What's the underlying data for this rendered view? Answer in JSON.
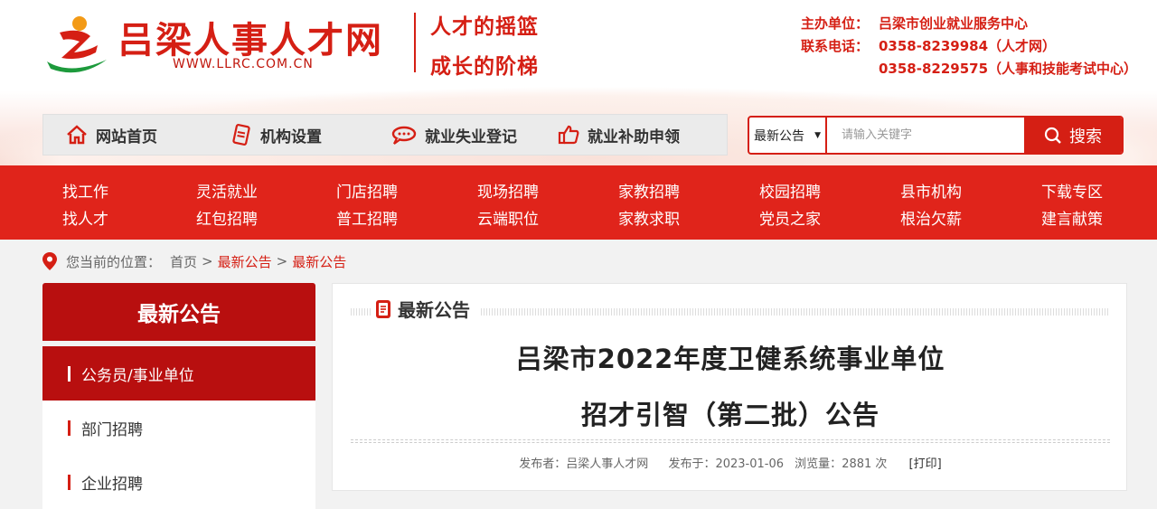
{
  "header": {
    "site_name": "吕梁人事人才网",
    "site_url": "WWW.LLRC.COM.CN",
    "slogan_1": "人才的摇篮",
    "slogan_2": "成长的阶梯",
    "host_label": "主办单位：",
    "host_value": "吕梁市创业就业服务中心",
    "phone_label": "联系电话：",
    "phone_1": "0358-8239984（人才网）",
    "phone_2": "0358-8229575（人事和技能考试中心）"
  },
  "topnav": [
    {
      "label": "网站首页",
      "icon": "home-icon"
    },
    {
      "label": "机构设置",
      "icon": "document-icon"
    },
    {
      "label": "就业失业登记",
      "icon": "chat-icon"
    },
    {
      "label": "就业补助申领",
      "icon": "thumbs-up-icon"
    }
  ],
  "search": {
    "category": "最新公告",
    "placeholder": "请输入关键字",
    "button": "搜索"
  },
  "rednav": {
    "row1": [
      "找工作",
      "灵活就业",
      "门店招聘",
      "现场招聘",
      "家教招聘",
      "校园招聘",
      "县市机构",
      "下载专区"
    ],
    "row2": [
      "找人才",
      "红包招聘",
      "普工招聘",
      "云端职位",
      "家教求职",
      "党员之家",
      "根治欠薪",
      "建言献策"
    ]
  },
  "breadcrumb": {
    "prefix": "您当前的位置：",
    "items": [
      "首页",
      "最新公告",
      "最新公告"
    ],
    "sep": ">"
  },
  "sidebar": {
    "title": "最新公告",
    "items": [
      "公务员/事业单位",
      "部门招聘",
      "企业招聘"
    ]
  },
  "article": {
    "section": "最新公告",
    "title_line1": "吕梁市2022年度卫健系统事业单位",
    "title_line2": "招才引智（第二批）公告",
    "publisher_label": "发布者：",
    "publisher": "吕梁人事人才网",
    "date_label": "发布于：",
    "date": "2023-01-06",
    "views_label": "浏览量：",
    "views": "2881 次",
    "print": "[打印]"
  },
  "colors": {
    "brand_red": "#d51f14",
    "nav_red": "#e0241b",
    "side_red": "#b80f0f"
  }
}
